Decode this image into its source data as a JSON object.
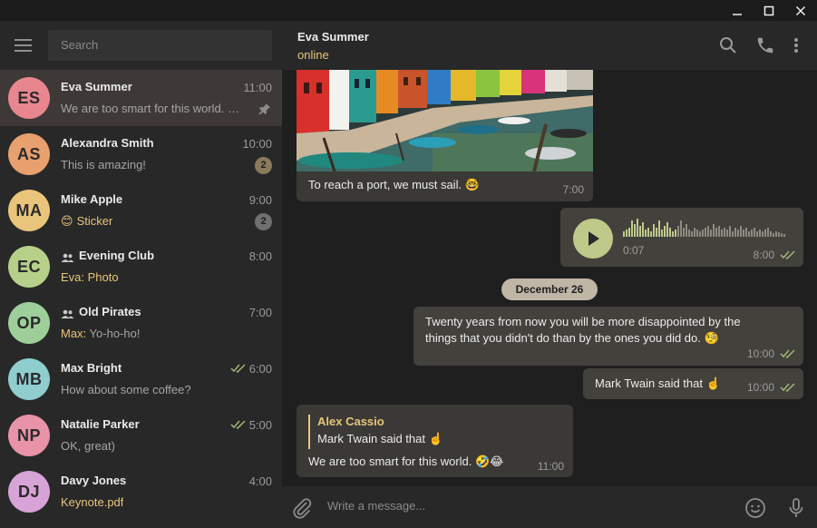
{
  "window": {
    "minimize_icon": "minimize-icon",
    "maximize_icon": "maximize-icon",
    "close_icon": "close-icon"
  },
  "sidebar": {
    "search_placeholder": "Search",
    "chats": [
      {
        "initials": "ES",
        "color": "#e8868f",
        "name": "Eva Summer",
        "time": "11:00",
        "preview": "We are too smart for this world. 🤣😂",
        "pinned": true,
        "active": true
      },
      {
        "initials": "AS",
        "color": "#e7a06e",
        "name": "Alexandra Smith",
        "time": "10:00",
        "preview": "This is amazing!",
        "badge": "2"
      },
      {
        "initials": "MA",
        "color": "#e9c47b",
        "name": "Mike Apple",
        "time": "9:00",
        "preview_emoji": "😊",
        "preview": "Sticker",
        "preview_accent": true,
        "badge": "2",
        "badge_muted": true
      },
      {
        "initials": "EC",
        "color": "#b6d08a",
        "name": "Evening Club",
        "group": true,
        "time": "8:00",
        "preview": "Eva: Photo",
        "preview_accent": true
      },
      {
        "initials": "OP",
        "color": "#9ecf9a",
        "name": "Old Pirates",
        "group": true,
        "time": "7:00",
        "sender": "Max:",
        "preview": " Yo-ho-ho!"
      },
      {
        "initials": "MB",
        "color": "#8fcdcf",
        "name": "Max Bright",
        "time": "6:00",
        "read": true,
        "preview": "How about some coffee?"
      },
      {
        "initials": "NP",
        "color": "#e893a8",
        "name": "Natalie Parker",
        "time": "5:00",
        "read": true,
        "preview": "OK, great)"
      },
      {
        "initials": "DJ",
        "color": "#d8a3d6",
        "name": "Davy Jones",
        "time": "4:00",
        "preview": "Keynote.pdf",
        "preview_accent": true
      }
    ]
  },
  "header": {
    "peer_name": "Eva Summer",
    "status": "online"
  },
  "messages": {
    "photo_caption": "To reach a port, we must sail. 🤓",
    "photo_time": "7:00",
    "voice_duration": "0:07",
    "voice_time": "8:00",
    "date_separator": "December 26",
    "quote_line1": "Twenty years from now you will be more disappointed by the",
    "quote_line2": "things that you didn't do than by the ones you did do. 🧐",
    "quote_time": "10:00",
    "twain_text": "Mark Twain said that ☝️",
    "twain_time": "10:00",
    "reply_author": "Alex Cassio",
    "reply_text": "Mark Twain said that ☝️",
    "reply_body": "We are too smart for this world. 🤣😂",
    "reply_time": "11:00"
  },
  "composer": {
    "placeholder": "Write a message..."
  },
  "colors": {
    "accent": "#e9c57b",
    "voice": "#bfc98a",
    "check": "#9fb878"
  }
}
